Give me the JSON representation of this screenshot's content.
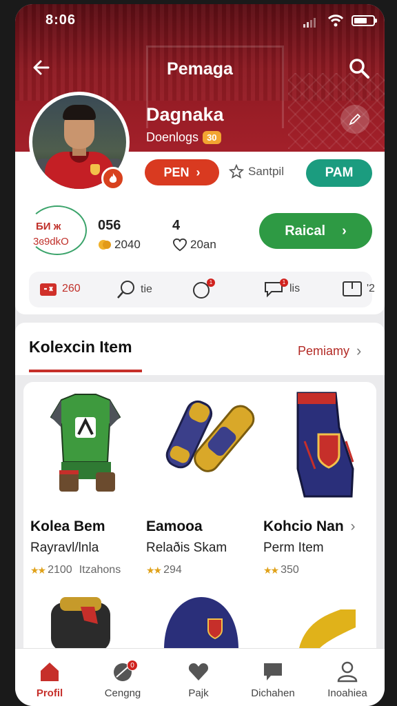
{
  "status": {
    "time": "8:06"
  },
  "header": {
    "title": "Pemaga"
  },
  "profile": {
    "name": "Dagnaka",
    "subtitle": "Doenlogs",
    "level": "30",
    "pen_label": "PEN",
    "sampil_label": "Santpil",
    "pam_label": "PAM"
  },
  "stats": {
    "ring_line1": "БИ ж",
    "ring_line2": "3ɞ9dkO",
    "stat1_value": "056",
    "stat1_sub": "2040",
    "stat2_value": "4",
    "stat2_sub": "20an",
    "cta_label": "Raical"
  },
  "actions": [
    {
      "label": "260",
      "icon": "gift-icon"
    },
    {
      "label": "tie",
      "icon": "pen-icon"
    },
    {
      "label": "",
      "icon": "heart-icon",
      "badge": "1"
    },
    {
      "label": "lis",
      "icon": "chat-icon",
      "badge": "1"
    },
    {
      "label": "'2",
      "icon": "flag-icon"
    }
  ],
  "section": {
    "title": "Kolexcin Item",
    "more": "Pemiamy"
  },
  "items": [
    {
      "name": "Kolea Bem",
      "sub": "Rayravl/lnla",
      "price": "2100",
      "extra": "Itzahons",
      "icon": "jersey-icon"
    },
    {
      "name": "Eamooa",
      "sub": "Relaðis Skam",
      "price": "294",
      "extra": "",
      "icon": "shin-guard-icon"
    },
    {
      "name": "Kohcio Nan",
      "sub": "Perm Item",
      "price": "350",
      "extra": "",
      "icon": "sock-icon"
    }
  ],
  "nav": [
    {
      "label": "Profil",
      "icon": "home-icon",
      "active": true
    },
    {
      "label": "Cengng",
      "icon": "ball-icon",
      "badge": "0"
    },
    {
      "label": "Pajk",
      "icon": "heart-icon"
    },
    {
      "label": "Dichahen",
      "icon": "chat-icon"
    },
    {
      "label": "Inoahiea",
      "icon": "user-icon"
    }
  ],
  "colors": {
    "brand_red": "#a3202a",
    "accent_orange": "#d93a20",
    "teal": "#1b9c7f",
    "green": "#2e9a44"
  }
}
